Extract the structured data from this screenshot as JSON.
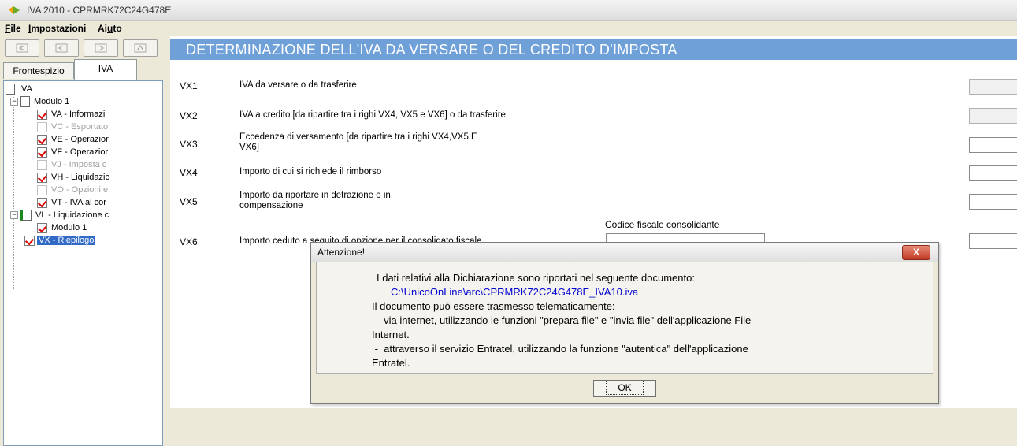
{
  "window": {
    "title": "IVA 2010 - CPRMRK72C24G478E"
  },
  "menu": [
    {
      "underline": "F",
      "rest": "ile"
    },
    {
      "underline": "I",
      "rest": "mpostazioni"
    },
    {
      "prefix": "Ai",
      "underline": "u",
      "rest": "to"
    }
  ],
  "tabs": {
    "frontespizio": "Frontespizio",
    "iva": "IVA"
  },
  "tree": {
    "root": "IVA",
    "modulo1": "Modulo 1",
    "items": [
      {
        "label": "VA - Informazi",
        "checked": true,
        "disabled": false
      },
      {
        "label": "VC - Esportato",
        "checked": false,
        "disabled": true
      },
      {
        "label": "VE - Operazior",
        "checked": true,
        "disabled": false
      },
      {
        "label": "VF - Operazior",
        "checked": true,
        "disabled": false
      },
      {
        "label": "VJ - Imposta c",
        "checked": false,
        "disabled": true
      },
      {
        "label": "VH - Liquidazic",
        "checked": true,
        "disabled": false
      },
      {
        "label": "VO - Opzioni e",
        "checked": false,
        "disabled": true
      },
      {
        "label": "VT - IVA al cor",
        "checked": true,
        "disabled": false
      }
    ],
    "vl": "VL - Liquidazione c",
    "vl_modulo": "Modulo 1",
    "vx": "VX - Riepilogo"
  },
  "main": {
    "header": "DETERMINAZIONE DELL'IVA DA VERSARE O DEL CREDITO D'IMPOSTA",
    "rows": [
      {
        "code": "VX1",
        "desc": "IVA da versare o da trasferire"
      },
      {
        "code": "VX2",
        "desc": "IVA a credito [da ripartire tra i righi VX4, VX5 e VX6] o da trasferire"
      },
      {
        "code": "VX3",
        "desc_line1": "Eccedenza di versamento [da ripartire tra i righi VX4,VX5 E",
        "desc_line2": "VX6]"
      },
      {
        "code": "VX4",
        "desc": "Importo di cui si richiede il rimborso"
      },
      {
        "code": "VX5",
        "desc_line1": "Importo da riportare in detrazione o in",
        "desc_line2": "compensazione"
      },
      {
        "code": "VX6",
        "desc": "Importo ceduto a seguito di opzione per il consolidato fiscale"
      }
    ],
    "codice_fiscale_label": "Codice fiscale consolidante"
  },
  "dialog": {
    "title": "Attenzione!",
    "close": "X",
    "lines": {
      "l1": "I dati relativi alla Dichiarazione sono riportati nel seguente documento:",
      "path": "C:\\UnicoOnLine\\arc\\CPRMRK72C24G478E_IVA10.iva",
      "l3": "Il documento può essere trasmesso telematicamente:",
      "l4": " -  via internet, utilizzando le funzioni \"prepara file\" e \"invia file\" dell'applicazione File",
      "l5": "Internet.",
      "l6": " -  attraverso il servizio Entratel, utilizzando la funzione \"autentica\" dell'applicazione",
      "l7": "Entratel."
    },
    "ok": "OK"
  }
}
